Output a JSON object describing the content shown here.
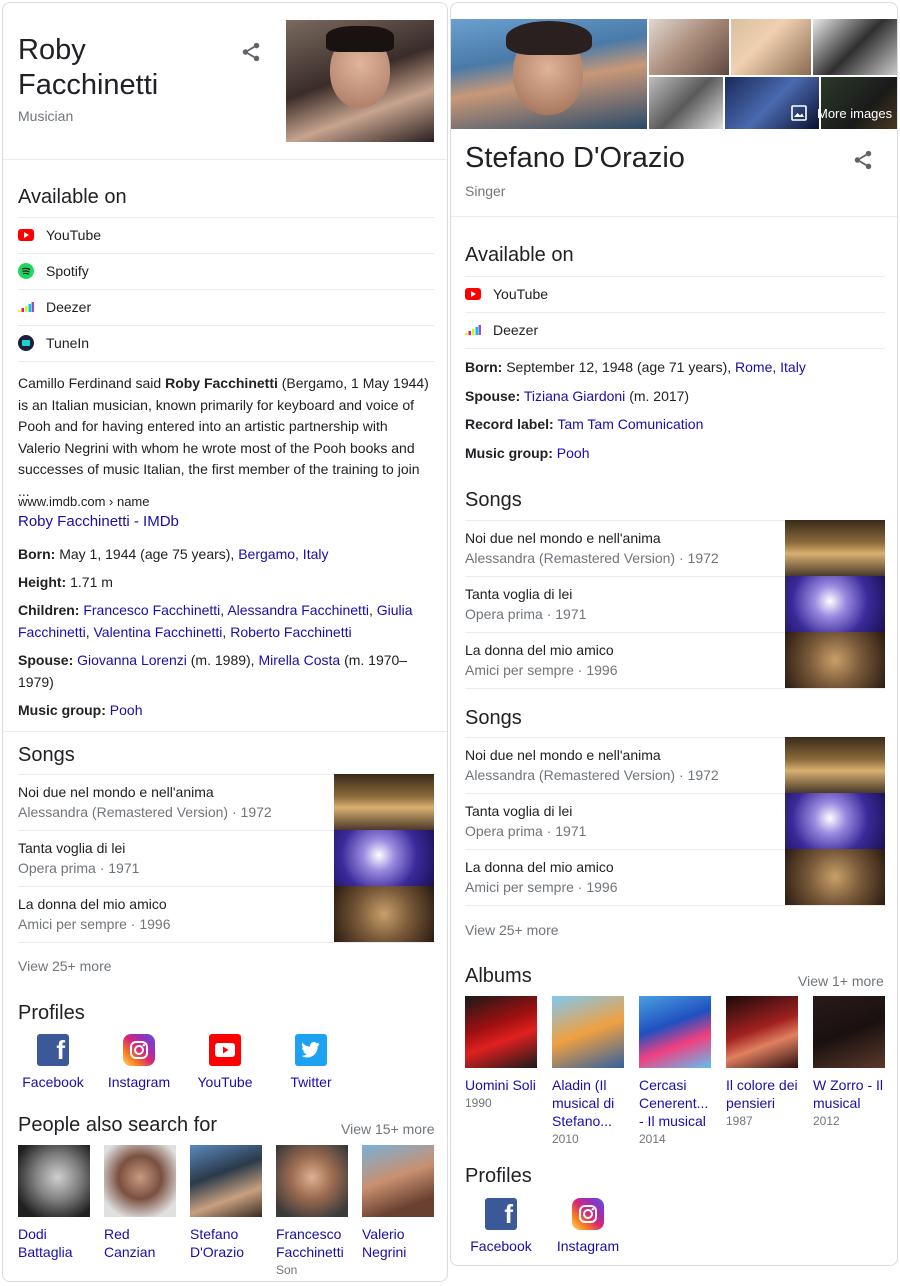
{
  "left": {
    "name_line1": "Roby",
    "name_line2": "Facchinetti",
    "subtitle": "Musician",
    "available_on_title": "Available on",
    "available": [
      "YouTube",
      "Spotify",
      "Deezer",
      "TuneIn"
    ],
    "bio_pre": "Camillo Ferdinand said ",
    "bio_bold": "Roby Facchinetti",
    "bio_post": " (Bergamo, 1 May 1944) is an Italian musician, known primarily for keyboard and voice of Pooh and for having entered into an artistic partnership with Valerio Negrini with whom he wrote most of the Pooh books and successes of music Italian, the first member of the training to join ...",
    "source_breadcrumb": "www.imdb.com › name",
    "source_link": "Roby Facchinetti - IMDb",
    "born_label": "Born:",
    "born_text": "May 1, 1944 (age 75 years),",
    "born_place": "Bergamo, Italy",
    "height_label": "Height:",
    "height_text": "1.71 m",
    "children_label": "Children:",
    "children": [
      "Francesco Facchinetti",
      "Alessandra Facchinetti",
      "Giulia Facchinetti",
      "Valentina Facchinetti",
      "Roberto Facchinetti"
    ],
    "spouse_label": "Spouse:",
    "spouse1": "Giovanna Lorenzi",
    "spouse1_meta": "(m. 1989),",
    "spouse2": "Mirella Costa",
    "spouse2_meta": "(m. 1970–1979)",
    "group_label": "Music group:",
    "group": "Pooh",
    "songs_title": "Songs",
    "songs": [
      {
        "name": "Noi due nel mondo e nell'anima",
        "meta": "Alessandra (Remastered Version) · 1972"
      },
      {
        "name": "Tanta voglia di lei",
        "meta": "Opera prima · 1971"
      },
      {
        "name": "La donna del mio amico",
        "meta": "Amici per sempre · 1996"
      }
    ],
    "songs_more": "View 25+ more",
    "profiles_title": "Profiles",
    "profiles": [
      "Facebook",
      "Instagram",
      "YouTube",
      "Twitter"
    ],
    "pasf_title": "People also search for",
    "pasf_more": "View 15+ more",
    "people": [
      {
        "l1": "Dodi",
        "l2": "Battaglia",
        "l3": ""
      },
      {
        "l1": "Red",
        "l2": "Canzian",
        "l3": ""
      },
      {
        "l1": "Stefano",
        "l2": "D'Orazio",
        "l3": ""
      },
      {
        "l1": "Francesco",
        "l2": "Facchinetti",
        "l3": "Son"
      },
      {
        "l1": "Valerio",
        "l2": "Negrini",
        "l3": ""
      }
    ]
  },
  "right": {
    "more_images": "More images",
    "name": "Stefano D'Orazio",
    "subtitle": "Singer",
    "available_on_title": "Available on",
    "available": [
      "YouTube",
      "Deezer"
    ],
    "born_label": "Born:",
    "born_text": "September 12, 1948 (age 71 years),",
    "born_place": "Rome, Italy",
    "spouse_label": "Spouse:",
    "spouse": "Tiziana Giardoni",
    "spouse_meta": "(m. 2017)",
    "label_label": "Record label:",
    "label": "Tam Tam Comunication",
    "group_label": "Music group:",
    "group": "Pooh",
    "songs_title": "Songs",
    "songs": [
      {
        "name": "Noi due nel mondo e nell'anima",
        "meta": "Alessandra (Remastered Version) · 1972"
      },
      {
        "name": "Tanta voglia di lei",
        "meta": "Opera prima · 1971"
      },
      {
        "name": "La donna del mio amico",
        "meta": "Amici per sempre · 1996"
      }
    ],
    "songs2_title": "Songs",
    "songs2": [
      {
        "name": "Noi due nel mondo e nell'anima",
        "meta": "Alessandra (Remastered Version) · 1972"
      },
      {
        "name": "Tanta voglia di lei",
        "meta": "Opera prima · 1971"
      },
      {
        "name": "La donna del mio amico",
        "meta": "Amici per sempre · 1996"
      }
    ],
    "songs_more": "View 25+ more",
    "albums_title": "Albums",
    "albums_more": "View 1+ more",
    "albums": [
      {
        "l1": "Uomini Soli",
        "l2": "",
        "l3": "",
        "year": "1990"
      },
      {
        "l1": "Aladin (Il",
        "l2": "musical di",
        "l3": "Stefano...",
        "year": "2010"
      },
      {
        "l1": "Cercasi",
        "l2": "Cenerent...",
        "l3": "- Il musical",
        "year": "2014"
      },
      {
        "l1": "Il colore dei",
        "l2": "pensieri",
        "l3": "",
        "year": "1987"
      },
      {
        "l1": "W Zorro - Il",
        "l2": "musical",
        "l3": "",
        "year": "2012"
      }
    ],
    "profiles_title": "Profiles",
    "profiles": [
      "Facebook",
      "Instagram"
    ]
  },
  "colors": {
    "link": "#1a0dab",
    "youtube": "#ff0000",
    "spotify": "#1ed760",
    "facebook": "#3b5998",
    "twitter": "#1da1f2",
    "tunein": "#14d8cc"
  }
}
